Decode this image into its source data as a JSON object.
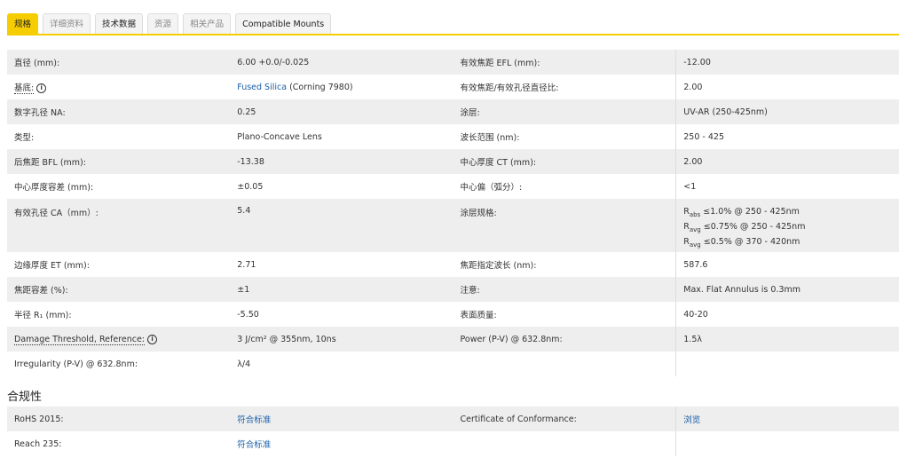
{
  "tabs": [
    "规格",
    "详细资料",
    "技术数据",
    "资源",
    "相关产品",
    "Compatible Mounts"
  ],
  "specs": [
    [
      "直径 (mm):",
      "6.00 +0.0/-0.025",
      "有效焦距 EFL (mm):",
      "-12.00"
    ],
    [
      "基底:",
      "Fused Silica",
      "有效焦距/有效孔径直径比:",
      "2.00"
    ],
    [
      "数字孔径 NA:",
      "0.25",
      "涂层:",
      "UV-AR (250-425nm)"
    ],
    [
      "类型:",
      "Plano-Concave Lens",
      "波长范围 (nm):",
      "250 - 425"
    ],
    [
      "后焦距 BFL (mm):",
      "-13.38",
      "中心厚度 CT (mm):",
      "2.00"
    ],
    [
      "中心厚度容差 (mm):",
      "±0.05",
      "中心偏（弧分）:",
      "<1"
    ],
    [
      "有效孔径 CA（mm）:",
      "5.4",
      "涂层规格:",
      ""
    ],
    [
      "边缘厚度 ET (mm):",
      "2.71",
      "焦距指定波长 (nm):",
      "587.6"
    ],
    [
      "焦距容差 (%):",
      "±1",
      "注意:",
      "Max. Flat Annulus is 0.3mm"
    ],
    [
      "半径 R₁ (mm):",
      "-5.50",
      "表面质量:",
      "40-20"
    ],
    [
      "Damage Threshold, Reference:",
      "3 J/cm² @ 355nm, 10ns",
      "Power (P-V) @ 632.8nm:",
      "1.5λ"
    ],
    [
      "Irregularity (P-V) @ 632.8nm:",
      "λ/4",
      "",
      ""
    ]
  ],
  "substrate_suffix": " (Corning 7980)",
  "info_glyph": "i",
  "coating_spec": [
    {
      "r": "R",
      "sub": "abs",
      "text": " ≤1.0% @ 250 - 425nm"
    },
    {
      "r": "R",
      "sub": "avg",
      "text": " ≤0.75% @ 250 - 425nm"
    },
    {
      "r": "R",
      "sub": "avg",
      "text": " ≤0.5% @ 370 - 420nm"
    }
  ],
  "compliance": {
    "title": "合规性",
    "rows": [
      [
        "RoHS 2015:",
        "符合标准",
        "Certificate of Conformance:",
        "浏览"
      ],
      [
        "Reach 235:",
        "符合标准",
        "",
        ""
      ]
    ]
  }
}
